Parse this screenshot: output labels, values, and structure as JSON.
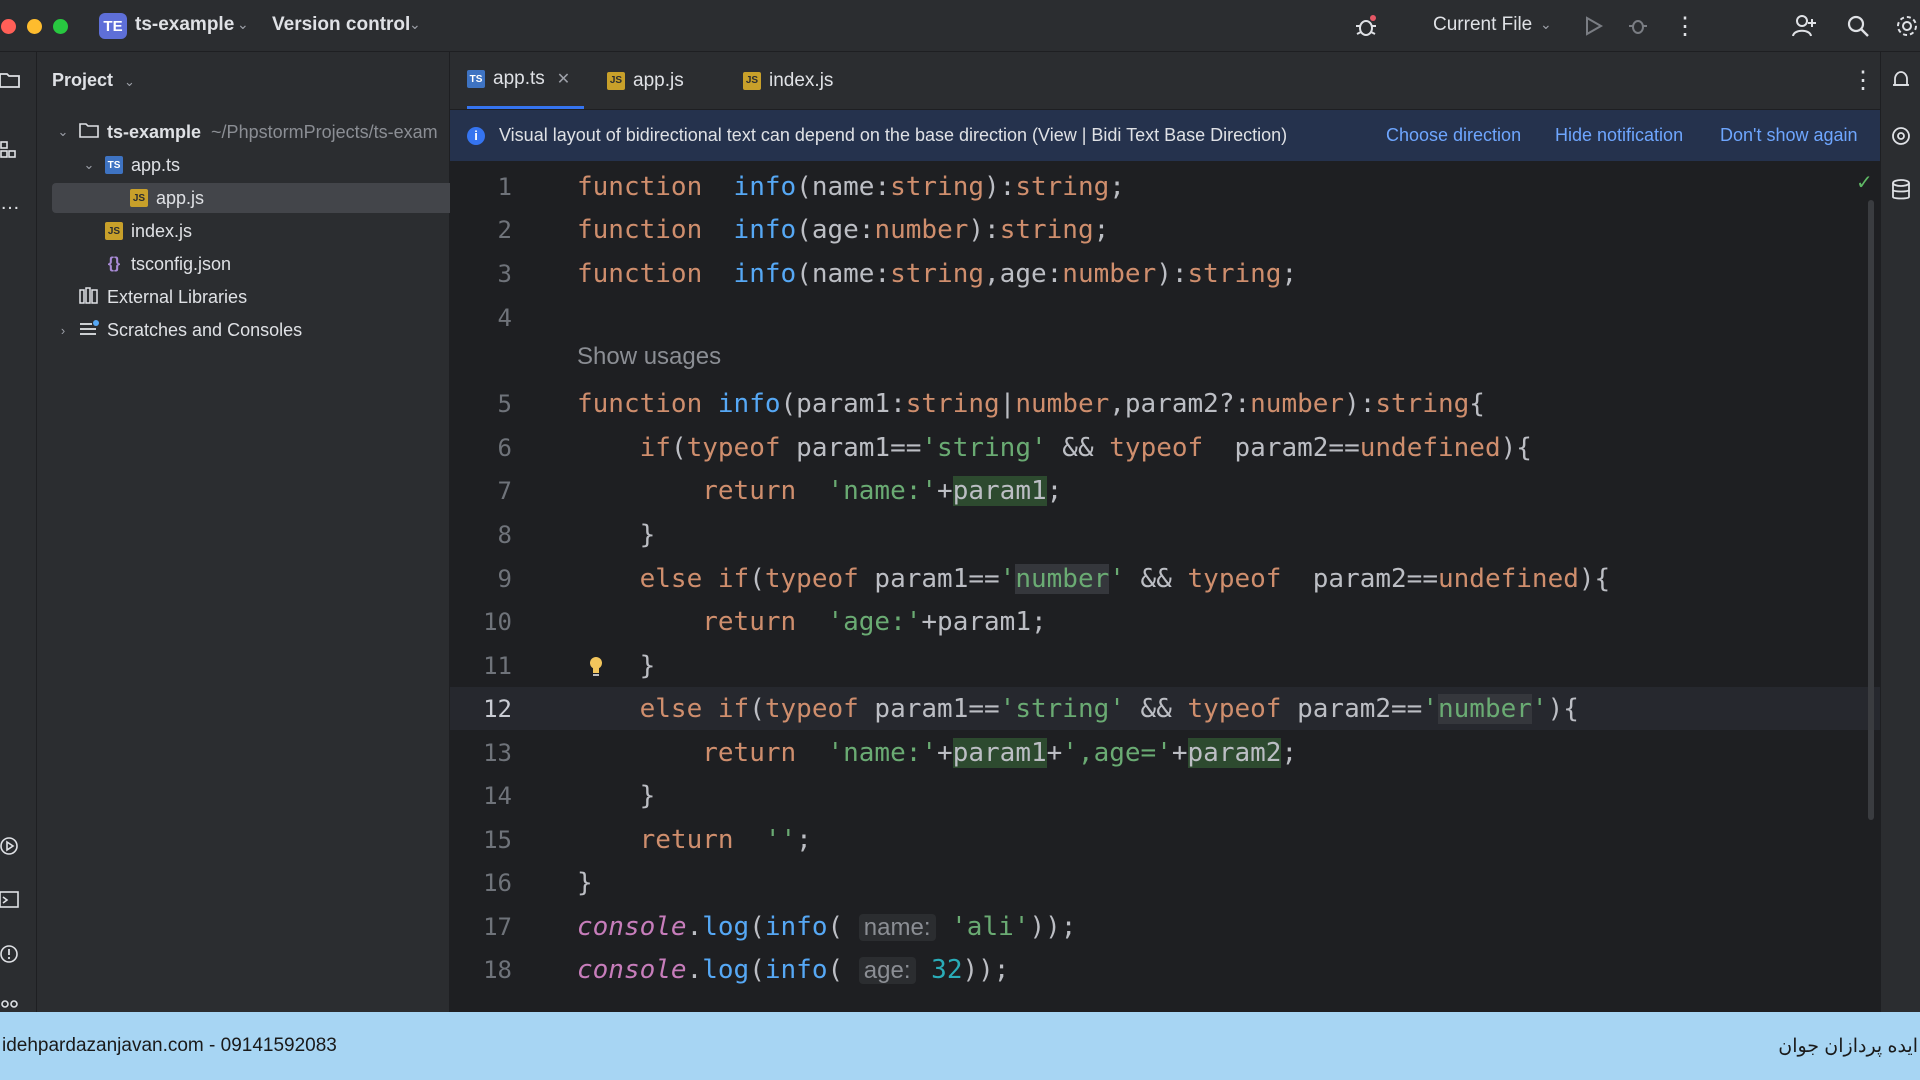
{
  "titlebar": {
    "project_badge": "TE",
    "project_name": "ts-example",
    "vcs_label": "Version control",
    "run_config": "Current File"
  },
  "project_panel": {
    "title": "Project",
    "tree": [
      {
        "label": "ts-example",
        "path": "~/PhpstormProjects/ts-exam"
      },
      {
        "label": "app.ts"
      },
      {
        "label": "app.js"
      },
      {
        "label": "index.js"
      },
      {
        "label": "tsconfig.json"
      },
      {
        "label": "External Libraries"
      },
      {
        "label": "Scratches and Consoles"
      }
    ]
  },
  "tabs": [
    {
      "label": "app.ts",
      "icon": "TS"
    },
    {
      "label": "app.js",
      "icon": "JS"
    },
    {
      "label": "index.js",
      "icon": "JS"
    }
  ],
  "notification": {
    "message": "Visual layout of bidirectional text can depend on the base direction (View | Bidi Text Base Direction)",
    "actions": [
      "Choose direction",
      "Hide notification",
      "Don't show again"
    ]
  },
  "editor": {
    "usages_hint": "Show usages",
    "line_numbers": [
      "1",
      "2",
      "3",
      "4",
      "5",
      "6",
      "7",
      "8",
      "9",
      "10",
      "11",
      "12",
      "13",
      "14",
      "15",
      "16",
      "17",
      "18"
    ],
    "lines": [
      [
        "function",
        "info",
        "(name:",
        "string",
        "):",
        "string",
        ";"
      ],
      [
        "function",
        "info",
        "(age:",
        "number",
        "):",
        "string",
        ";"
      ],
      [
        "function",
        "info",
        "(name:",
        "string",
        ",age:",
        "number",
        "):",
        "string",
        ";"
      ],
      [],
      [
        "function",
        "info",
        "(param1:",
        "string",
        "|",
        "number",
        ",param2?:",
        "number",
        "):",
        "string",
        "{"
      ],
      [
        "if",
        "(",
        "typeof",
        " param1==",
        "'string'",
        " && ",
        "typeof",
        "  param2==",
        "undefined",
        "){"
      ],
      [
        "return",
        "'name:'",
        "+",
        "param1",
        ";"
      ],
      [
        "}"
      ],
      [
        "else if",
        "(",
        "typeof",
        " param1==",
        "'",
        "number",
        "'",
        " && ",
        "typeof",
        "  param2==",
        "undefined",
        "){"
      ],
      [
        "return",
        "'age:'",
        "+",
        "param1",
        ";"
      ],
      [
        "}"
      ],
      [
        "else if",
        "(",
        "typeof",
        " param1==",
        "'string'",
        " && ",
        "typeof",
        " param2==",
        "'",
        "number",
        "'",
        "){"
      ],
      [
        "return",
        "'name:'",
        "+",
        "param1",
        "+",
        "',age='",
        "+",
        "param2",
        ";"
      ],
      [
        "}"
      ],
      [
        "return",
        "''",
        ";"
      ],
      [
        "}"
      ],
      [
        "console",
        ".",
        "log",
        "(",
        "info",
        "(",
        "name:",
        "'ali'",
        "));"
      ],
      [
        "console",
        ".",
        "log",
        "(",
        "info",
        "(",
        "age:",
        "32",
        "));"
      ]
    ]
  },
  "footer": {
    "left": "idehpardazanjavan.com - 09141592083",
    "right": "ایده پردازان جوان"
  }
}
